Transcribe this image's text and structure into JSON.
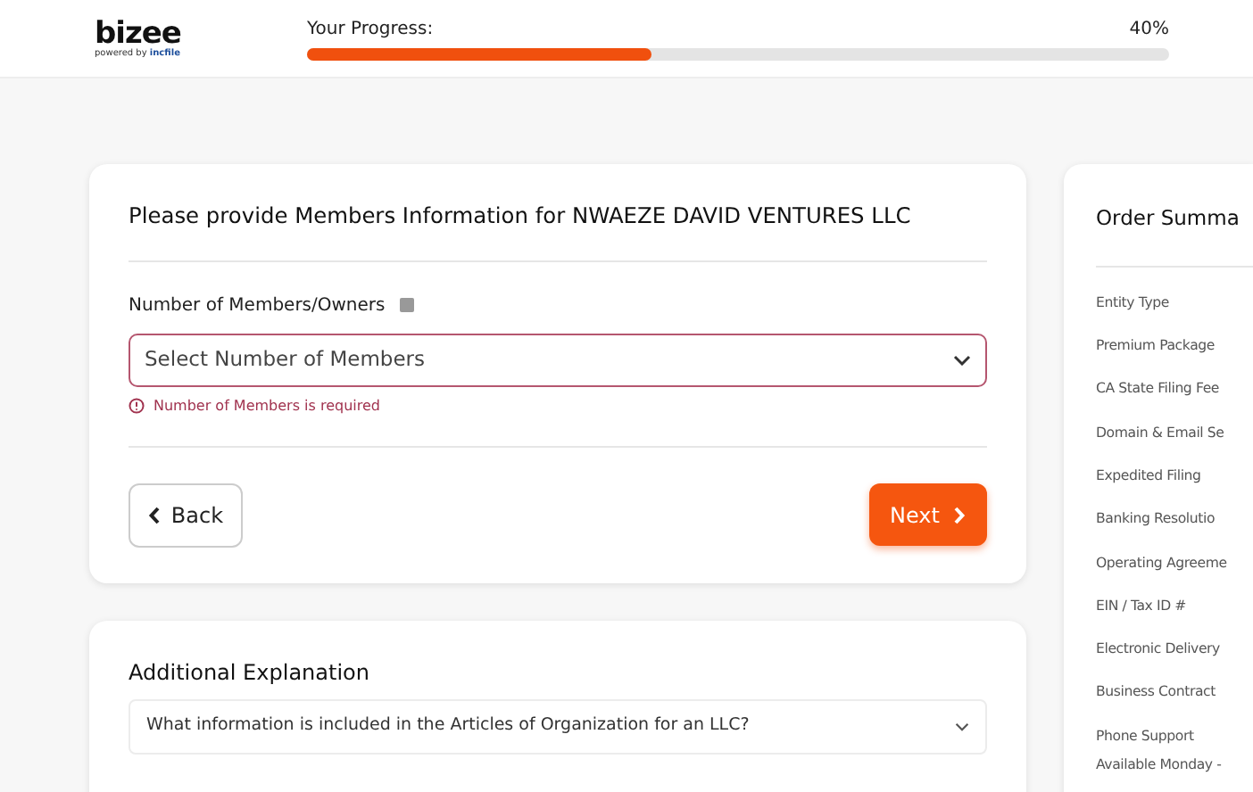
{
  "header": {
    "logo": "bizee",
    "logo_tagline": "powered by",
    "logo_brand": "incfile",
    "progress_label": "Your Progress:",
    "progress_reading": "40%",
    "progress": {
      "level": 0.4
    }
  },
  "members_card": {
    "title": "Please provide Members Information for NWAEZE DAVID VENTURES LLC",
    "field_label": "Number of Members/Owners",
    "select_placeholder": "Select Number of Members",
    "error": "Number of Members is required",
    "back_button": "Back",
    "next_button": "Next"
  },
  "explanation_card": {
    "title": "Additional Explanation",
    "question": "What information is included in the Articles of Organization for an LLC?",
    "expanded": false
  },
  "order_summary": {
    "title": "Order Summa",
    "items": [
      "Entity Type",
      "Premium Package",
      "CA State Filing Fee",
      "Domain & Email Se",
      "Expedited Filing",
      "Banking Resolutio",
      "Operating Agreeme",
      "EIN / Tax ID #",
      "Electronic Delivery",
      "Business Contract",
      "Phone Support",
      "Available Monday -"
    ]
  }
}
